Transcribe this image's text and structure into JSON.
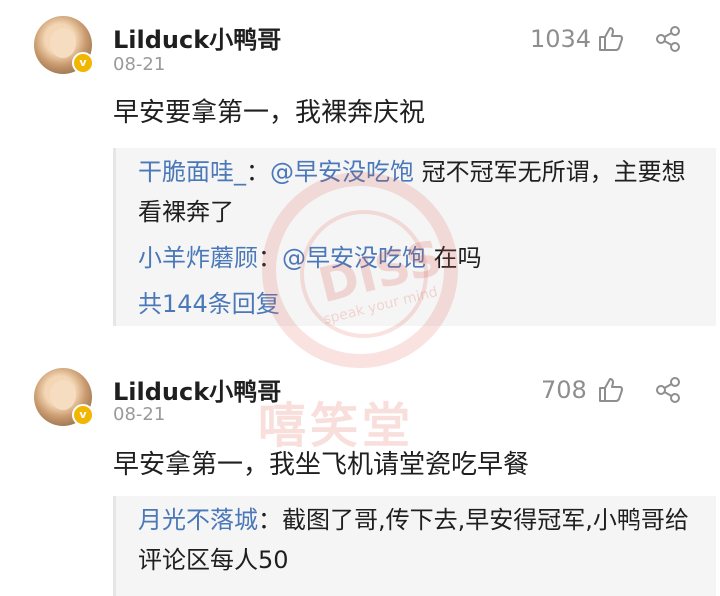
{
  "comments": [
    {
      "username": "Lilduck小鸭哥",
      "date": "08-21",
      "likes": "1034",
      "content": "早安要拿第一，我裸奔庆祝",
      "replies": [
        {
          "name": "干脆面哇_",
          "sep": "：",
          "mention": "@早安没吃饱",
          "text": " 冠不冠军无所谓，主要想看裸奔了"
        },
        {
          "name": "小羊炸蘑顾",
          "sep": "：",
          "mention": "@早安没吃饱",
          "text": " 在吗"
        }
      ],
      "more": "共144条回复"
    },
    {
      "username": "Lilduck小鸭哥",
      "date": "08-21",
      "likes": "708",
      "content": "早安拿第一，我坐飞机请堂瓷吃早餐",
      "replies": [
        {
          "name": "月光不落城",
          "sep": "：",
          "mention": "",
          "text": "截图了哥,传下去,早安得冠军,小鸭哥给评论区每人50"
        }
      ]
    }
  ],
  "watermark": {
    "stamp": "DISS",
    "stamp_sub": "speak your mind",
    "brand": "嘻笑堂"
  },
  "colors": {
    "link": "#4a78b8",
    "muted": "#9a9a9a",
    "badge": "#f2b500"
  }
}
